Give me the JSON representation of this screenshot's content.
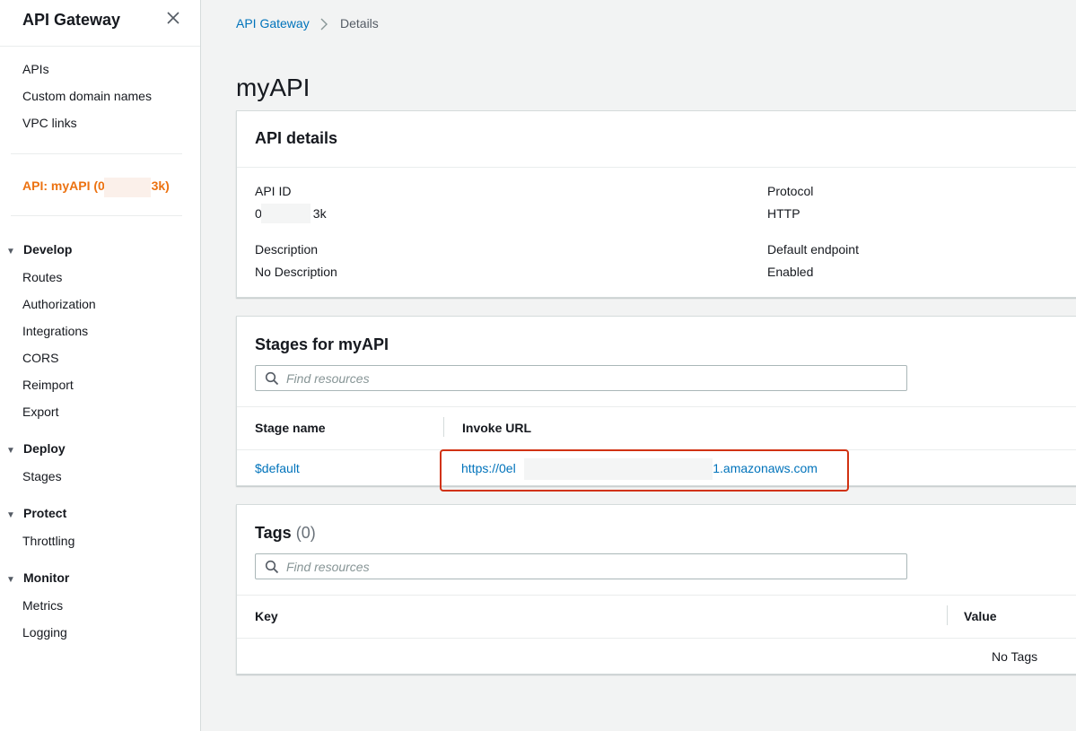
{
  "sidebar": {
    "title": "API Gateway",
    "close_icon": "close-icon",
    "top_links": [
      "APIs",
      "Custom domain names",
      "VPC links"
    ],
    "api_label": "API: myAPI (0e",
    "api_label_end": "3k)",
    "sections": [
      {
        "label": "Develop",
        "items": [
          "Routes",
          "Authorization",
          "Integrations",
          "CORS",
          "Reimport",
          "Export"
        ]
      },
      {
        "label": "Deploy",
        "items": [
          "Stages"
        ]
      },
      {
        "label": "Protect",
        "items": [
          "Throttling"
        ]
      },
      {
        "label": "Monitor",
        "items": [
          "Metrics",
          "Logging"
        ]
      }
    ]
  },
  "breadcrumb": {
    "parent": "API Gateway",
    "current": "Details"
  },
  "page_title": "myAPI",
  "api_details": {
    "heading": "API details",
    "api_id_label": "API ID",
    "api_id_value_start": "0",
    "api_id_value_end": "3k",
    "protocol_label": "Protocol",
    "protocol_value": "HTTP",
    "description_label": "Description",
    "description_value": "No Description",
    "endpoint_label": "Default endpoint",
    "endpoint_value": "Enabled"
  },
  "stages": {
    "heading": "Stages for myAPI",
    "search_placeholder": "Find resources",
    "columns": [
      "Stage name",
      "Invoke URL"
    ],
    "rows": [
      {
        "stage": "$default",
        "url_start": "https://0el",
        "url_end": "st-1.amazonaws.com"
      }
    ]
  },
  "tags": {
    "heading": "Tags",
    "count": "(0)",
    "search_placeholder": "Find resources",
    "columns": [
      "Key",
      "Value"
    ],
    "empty": "No Tags"
  },
  "colors": {
    "link": "#0073bb",
    "active": "#ec7211",
    "highlight": "#d13212",
    "background": "#f2f3f3"
  }
}
